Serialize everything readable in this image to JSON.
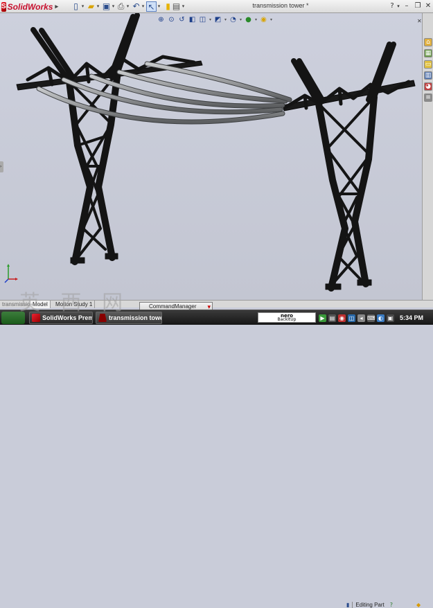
{
  "app": {
    "logo_text": "SolidWorks",
    "document_title": "transmission tower *",
    "help_label": "?"
  },
  "toolbar": {
    "icons": [
      "new-icon",
      "open-icon",
      "save-icon",
      "print-icon",
      "undo-icon",
      "select-icon",
      "rebuild-icon",
      "options-icon"
    ]
  },
  "view_toolbar": {
    "icons": [
      "zoom-to-fit-icon",
      "zoom-area-icon",
      "previous-view-icon",
      "section-view-icon",
      "view-orientation-icon",
      "display-style-icon",
      "hide-show-icon",
      "edit-appearance-icon",
      "apply-scene-icon"
    ]
  },
  "task_pane": {
    "icons": [
      "home-icon",
      "design-library-icon",
      "file-explorer-icon",
      "view-palette-icon",
      "appearances-icon",
      "custom-properties-icon"
    ]
  },
  "tabs": {
    "truncated_doc": "transmission...",
    "model_tab": "Model",
    "motion_tab": "Motion Study 1",
    "command_manager": "CommandManager"
  },
  "status": {
    "editing": "Editing Part"
  },
  "taskbar": {
    "buttons": [
      {
        "label": "SolidWorks Premi..."
      },
      {
        "label": "transmission tower"
      }
    ],
    "nero_line1": "nero",
    "nero_line2": "BackItUp",
    "clock": "5:34 PM"
  },
  "watermark": "英  西  网",
  "colors": {
    "viewport_bg": "#c9ccd9",
    "steel": "#141414",
    "cable": "#9a9c9e",
    "brand": "#c8102e"
  }
}
